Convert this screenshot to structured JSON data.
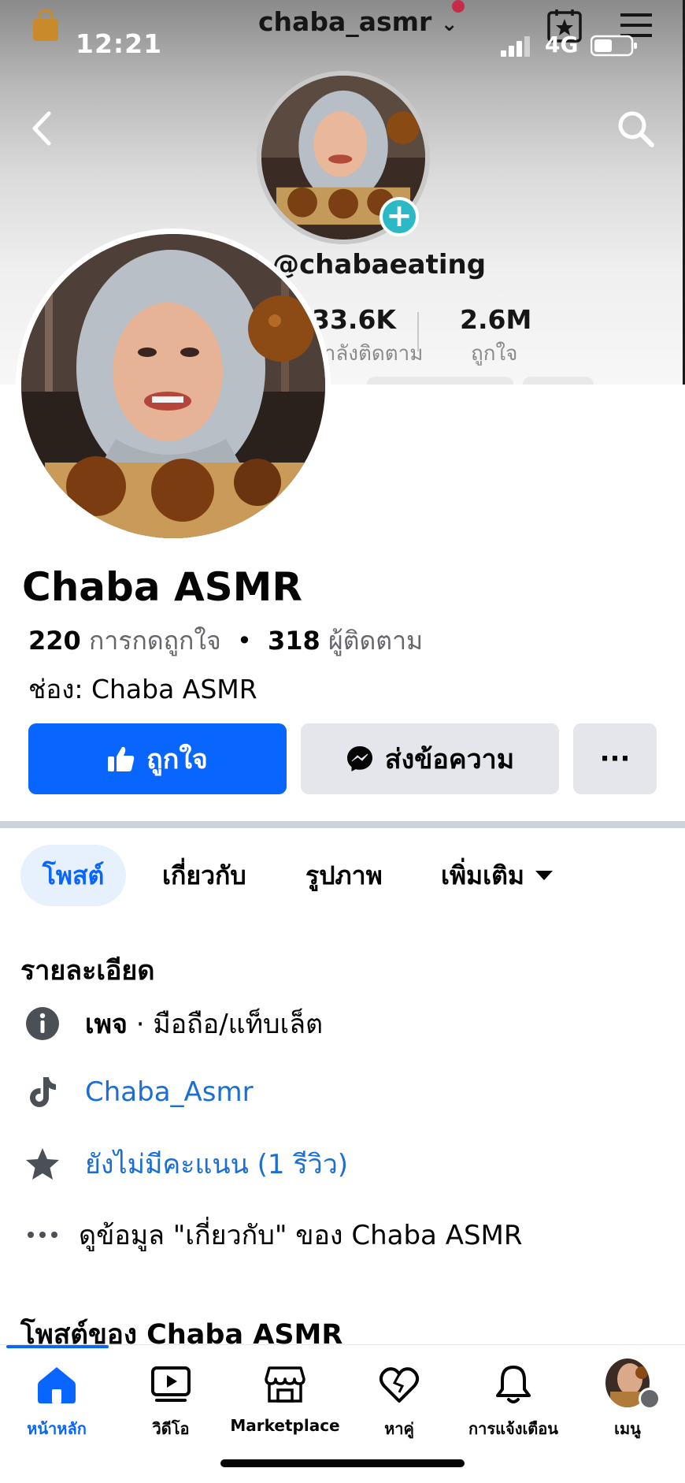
{
  "status_bar": {
    "time": "12:21",
    "network": "4G"
  },
  "cover": {
    "username": "chaba_asmr",
    "handle": "@chabaeating",
    "following_count": "33.6K",
    "following_label": "กำลังติดตาม",
    "likes_count": "2.6M",
    "likes_label": "ถูกใจ"
  },
  "page": {
    "name": "Chaba ASMR",
    "likes_count": "220",
    "likes_label": "การกดถูกใจ",
    "followers_count": "318",
    "followers_label": "ผู้ติดตาม",
    "channel": "ช่อง: Chaba ASMR"
  },
  "actions": {
    "like_label": "ถูกใจ",
    "message_label": "ส่งข้อความ",
    "more_label": "···"
  },
  "tabs": [
    {
      "label": "โพสต์",
      "active": true
    },
    {
      "label": "เกี่ยวกับ",
      "active": false
    },
    {
      "label": "รูปภาพ",
      "active": false
    },
    {
      "label": "เพิ่มเติม",
      "active": false
    }
  ],
  "details": {
    "title": "รายละเอียด",
    "page_type_bold": "เพจ",
    "page_type_rest": " · มือถือ/แท็บเล็ต",
    "tiktok": "Chaba_Asmr",
    "rating": "ยังไม่มีคะแนน (1 รีวิว)",
    "about_link": "ดูข้อมูล \"เกี่ยวกับ\" ของ Chaba ASMR"
  },
  "posts_heading": "โพสต์ของ Chaba ASMR",
  "bottom_nav": [
    {
      "label": "หน้าหลัก",
      "icon": "home-icon",
      "active": true
    },
    {
      "label": "วิดีโอ",
      "icon": "video-icon",
      "active": false
    },
    {
      "label": "Marketplace",
      "icon": "marketplace-icon",
      "active": false
    },
    {
      "label": "หาคู่",
      "icon": "dating-icon",
      "active": false
    },
    {
      "label": "การแจ้งเตือน",
      "icon": "bell-icon",
      "active": false
    },
    {
      "label": "เมนู",
      "icon": "menu-avatar",
      "active": false
    }
  ],
  "colors": {
    "brand_blue": "#0866ff",
    "link_blue": "#1a6ed4",
    "gray_button": "#e4e6eb",
    "teal_plus": "#2bb9c5"
  }
}
